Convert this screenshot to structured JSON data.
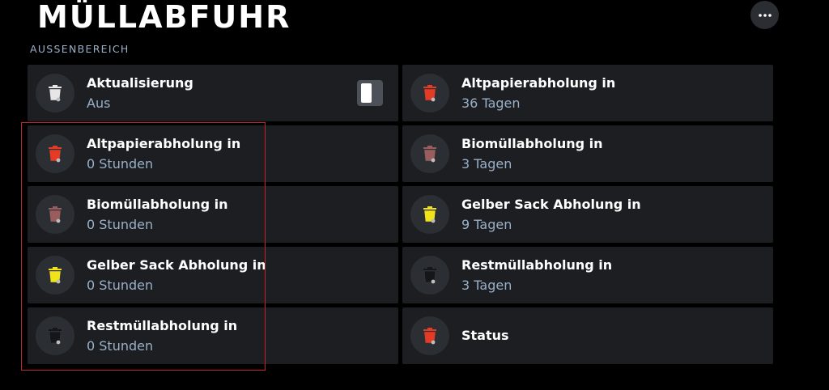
{
  "header": {
    "title": "MÜLLABFUHR",
    "section_label": "AUSSENBEREICH",
    "more_icon": "more-horizontal-icon"
  },
  "colors": {
    "background": "#000000",
    "tile": "#1c1e21",
    "icon_circle": "#2b2e33",
    "secondary_text": "#9ab0c8",
    "bin_red": "#e53a24",
    "bin_brown": "#9a5d5d",
    "bin_yellow": "#f1e21a",
    "bin_black": "#15161a",
    "bin_white": "#e6e6e6",
    "highlight": "#c0272d"
  },
  "tiles": [
    {
      "name": "Aktualisierung",
      "value": "Aus",
      "icon": "trash-bin-icon",
      "bin_color": "#e6e6e6",
      "toggle": true,
      "toggle_state": "off"
    },
    {
      "name": "Altpapierabholung in",
      "value": "36 Tagen",
      "icon": "trash-bin-icon",
      "bin_color": "#e53a24"
    },
    {
      "name": "Altpapierabholung in",
      "value": "0 Stunden",
      "icon": "trash-bin-icon",
      "bin_color": "#e53a24"
    },
    {
      "name": "Biomüllabholung in",
      "value": "3 Tagen",
      "icon": "trash-bin-icon",
      "bin_color": "#9a5d5d"
    },
    {
      "name": "Biomüllabholung in",
      "value": "0 Stunden",
      "icon": "trash-bin-icon",
      "bin_color": "#9a5d5d"
    },
    {
      "name": "Gelber Sack Abholung in",
      "value": "9 Tagen",
      "icon": "trash-bin-icon",
      "bin_color": "#f1e21a"
    },
    {
      "name": "Gelber Sack Abholung in",
      "value": "0 Stunden",
      "icon": "trash-bin-icon",
      "bin_color": "#f1e21a"
    },
    {
      "name": "Restmüllabholung in",
      "value": "3 Tagen",
      "icon": "trash-bin-icon",
      "bin_color": "#15161a"
    },
    {
      "name": "Restmüllabholung in",
      "value": "0 Stunden",
      "icon": "trash-bin-icon",
      "bin_color": "#15161a"
    },
    {
      "name": "Status",
      "value": "",
      "icon": "trash-bin-icon",
      "bin_color": "#e53a24"
    }
  ]
}
